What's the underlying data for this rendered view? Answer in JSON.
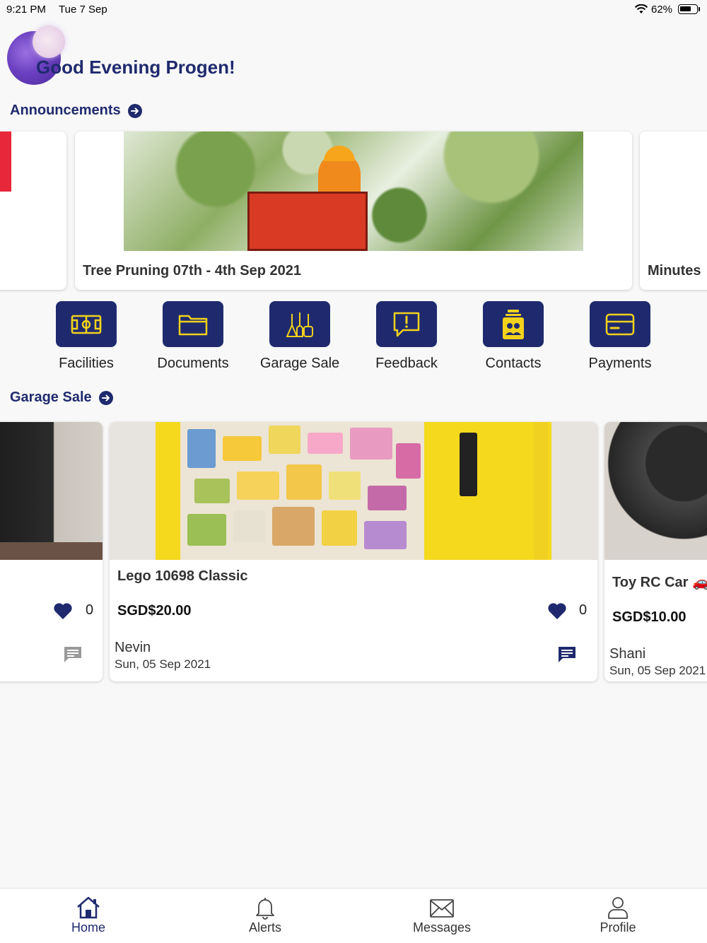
{
  "status_bar": {
    "time": "9:21 PM",
    "date": "Tue 7 Sep",
    "battery": "62%"
  },
  "header": {
    "greeting": "Good Evening Progen!"
  },
  "announcements": {
    "title": "Announcements",
    "cards": [
      {
        "title": "Tree Pruning 07th - 4th Sep 2021"
      },
      {
        "title": "Minutes"
      }
    ]
  },
  "quick_actions": [
    {
      "label": "Facilities",
      "icon": "stadium-icon"
    },
    {
      "label": "Documents",
      "icon": "folder-icon"
    },
    {
      "label": "Garage Sale",
      "icon": "garage-sale-icon"
    },
    {
      "label": "Feedback",
      "icon": "feedback-icon"
    },
    {
      "label": "Contacts",
      "icon": "contacts-icon"
    },
    {
      "label": "Payments",
      "icon": "credit-card-icon"
    }
  ],
  "garage_sale": {
    "title": "Garage Sale",
    "items": [
      {
        "likes": "0"
      },
      {
        "title": "Lego 10698 Classic",
        "price": "SGD$20.00",
        "likes": "0",
        "seller": "Nevin",
        "date": "Sun, 05 Sep 2021"
      },
      {
        "title": "Toy RC Car 🚗",
        "price": "SGD$10.00",
        "seller": "Shani",
        "date": "Sun, 05 Sep 2021"
      }
    ]
  },
  "tabbar": {
    "tabs": [
      {
        "label": "Home",
        "icon": "home-icon",
        "active": true
      },
      {
        "label": "Alerts",
        "icon": "bell-icon"
      },
      {
        "label": "Messages",
        "icon": "envelope-icon"
      },
      {
        "label": "Profile",
        "icon": "person-icon"
      }
    ]
  },
  "colors": {
    "primary": "#1f2a6e",
    "icon_accent": "#f2d21b",
    "alert_red": "#e8283a"
  }
}
